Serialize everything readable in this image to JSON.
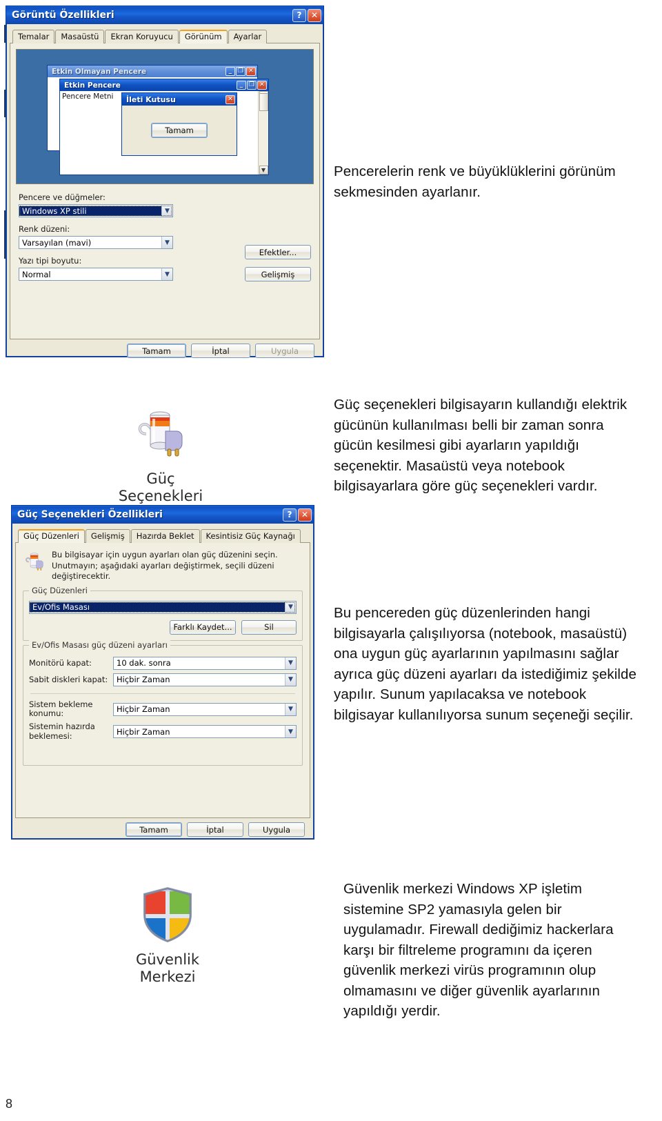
{
  "page": {
    "number": "8"
  },
  "display_dialog": {
    "title": "Görüntü Özellikleri",
    "help_btn": "?",
    "close_btn": "✕",
    "tabs": [
      {
        "label": "Temalar",
        "active": false
      },
      {
        "label": "Masaüstü",
        "active": false
      },
      {
        "label": "Ekran Koruyucu",
        "active": false
      },
      {
        "label": "Görünüm",
        "active": true
      },
      {
        "label": "Ayarlar",
        "active": false
      }
    ],
    "preview": {
      "inactive_window_title": "Etkin Olmayan Pencere",
      "active_window_title": "Etkin Pencere",
      "window_text": "Pencere Metni",
      "msgbox_title": "İleti Kutusu",
      "msgbox_ok": "Tamam",
      "min_glyph": "_",
      "max_glyph": "❐",
      "close_glyph": "✕",
      "scroll_up": "▲",
      "scroll_down": "▼"
    },
    "fields": [
      {
        "label": "Pencere ve düğmeler:",
        "value": "Windows XP stili",
        "selected": true
      },
      {
        "label": "Renk düzeni:",
        "value": "Varsayılan (mavi)",
        "selected": false
      },
      {
        "label": "Yazı tipi boyutu:",
        "value": "Normal",
        "selected": false
      }
    ],
    "side_buttons": [
      {
        "label": "Efektler..."
      },
      {
        "label": "Gelişmiş"
      }
    ],
    "footer_buttons": [
      {
        "label": "Tamam",
        "style": "default"
      },
      {
        "label": "İptal",
        "style": "normal"
      },
      {
        "label": "Uygula",
        "style": "disabled"
      }
    ]
  },
  "para_appearance": "Pencerelerin renk ve büyüklüklerini görünüm sekmesinden ayarlanır.",
  "power_icon": {
    "caption_line1": "Güç",
    "caption_line2": "Seçenekleri",
    "icon_name": "power-options-icon"
  },
  "para_power_intro": "Güç seçenekleri bilgisayarın kullandığı elektrik gücünün kullanılması belli bir zaman sonra gücün kesilmesi gibi ayarların yapıldığı seçenektir. Masaüstü veya notebook bilgisayarlara göre güç seçenekleri vardır.",
  "power_dialog": {
    "title": "Güç Seçenekleri Özellikleri",
    "help_btn": "?",
    "close_btn": "✕",
    "tabs": [
      {
        "label": "Güç Düzenleri",
        "active": true
      },
      {
        "label": "Gelişmiş",
        "active": false
      },
      {
        "label": "Hazırda Beklet",
        "active": false
      },
      {
        "label": "Kesintisiz Güç Kaynağı",
        "active": false
      }
    ],
    "info_text": "Bu bilgisayar için uygun ayarları olan güç düzenini seçin. Unutmayın; aşağıdaki ayarları değiştirmek, seçili düzeni değiştirecektir.",
    "scheme_group_legend": "Güç Düzenleri",
    "scheme_value": "Ev/Ofis Masası",
    "scheme_buttons": [
      {
        "label": "Farklı Kaydet..."
      },
      {
        "label": "Sil"
      }
    ],
    "settings_group_legend": "Ev/Ofis Masası güç düzeni ayarları",
    "settings_rows": [
      {
        "label": "Monitörü kapat:",
        "value": "10 dak. sonra"
      },
      {
        "label": "Sabit diskleri kapat:",
        "value": "Hiçbir Zaman"
      },
      {
        "label": "Sistem bekleme konumu:",
        "value": "Hiçbir Zaman"
      },
      {
        "label": "Sistemin hazırda beklemesi:",
        "value": "Hiçbir Zaman"
      }
    ],
    "footer_buttons": [
      {
        "label": "Tamam",
        "style": "default"
      },
      {
        "label": "İptal",
        "style": "normal"
      },
      {
        "label": "Uygula",
        "style": "normal"
      }
    ]
  },
  "para_power_window": "Bu pencereden güç düzenlerinden hangi bilgisayarla çalışılıyorsa (notebook, masaüstü) ona uygun güç ayarlarının yapılmasını sağlar ayrıca güç düzeni ayarları da istediğimiz şekilde yapılır. Sunum yapılacaksa ve notebook bilgisayar kullanılıyorsa sunum seçeneği seçilir.",
  "security_icon": {
    "caption_line1": "Güvenlik",
    "caption_line2": "Merkezi",
    "icon_name": "security-center-shield-icon"
  },
  "para_security": "Güvenlik merkezi Windows XP işletim sistemine SP2 yamasıyla gelen bir uygulamadır. Firewall dediğimiz hackerlara karşı bir filtreleme programını da içeren güvenlik merkezi virüs programının olup olmamasını ve diğer güvenlik ayarlarının yapıldığı yerdir.",
  "colors": {
    "xp_title_blue": "#0f51c2",
    "xp_face": "#ece9d8",
    "accent_orange": "#f0a31a",
    "selection_blue": "#0a246a",
    "rule_navy": "#1f3864"
  }
}
